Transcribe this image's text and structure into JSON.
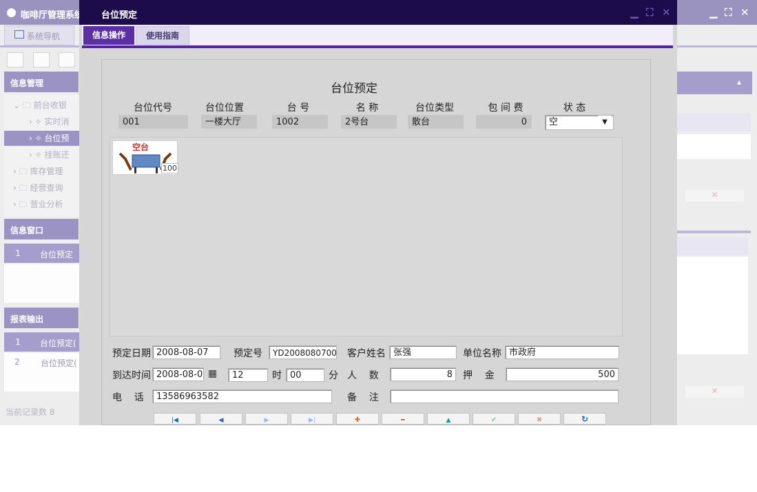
{
  "app": {
    "title": "咖啡厅管理系统",
    "nav_tab": "系统导航",
    "panels": {
      "info_manage": "信息管理",
      "info_window": "信息窗口",
      "report_output": "报表输出"
    },
    "tree": [
      {
        "label": "前台收银",
        "arrow": "⌄",
        "icon": "folder-icon"
      },
      {
        "label": "实时消",
        "arrow": "›",
        "icon": "tool-icon"
      },
      {
        "label": "台位预",
        "arrow": "›",
        "icon": "tool-icon",
        "selected": true
      },
      {
        "label": "挂账还",
        "arrow": "›",
        "icon": "tool-icon"
      },
      {
        "label": "库存管理",
        "arrow": "›",
        "icon": "folder-icon"
      },
      {
        "label": "经营查询",
        "arrow": "›",
        "icon": "folder-icon"
      },
      {
        "label": "营业分析",
        "arrow": "›",
        "icon": "folder-icon"
      }
    ],
    "info_window_grid": {
      "num": "1",
      "cell": "台位预定"
    },
    "report_grid": {
      "head_num": "1",
      "head_cell": "台位预定(",
      "row_num": "2",
      "row_cell": "台位预定("
    },
    "status": "当前记录数 8"
  },
  "dialog": {
    "title": "台位预定",
    "tabs": [
      "信息操作",
      "使用指南"
    ],
    "form_title": "台位预定",
    "columns": [
      "台位代号",
      "台位位置",
      "台 号",
      "名 称",
      "台位类型",
      "包 间 费",
      "状 态"
    ],
    "values": {
      "code": "001",
      "location": "一楼大厅",
      "table_no": "1002",
      "name": "2号台",
      "type": "散台",
      "room_fee": "0",
      "status": "空"
    },
    "table_card": {
      "sign": "空台",
      "number": "100"
    },
    "fields": {
      "reserve_date_label": "预定日期",
      "reserve_date": "2008-08-07",
      "reserve_no_label": "预定号",
      "reserve_no": "YD2008080700",
      "customer_label": "客户姓名",
      "customer": "张强",
      "company_label": "单位名称",
      "company": "市政府",
      "arrive_label": "到达时间",
      "arrive_date": "2008-08-0",
      "hour": "12",
      "hour_label": "时",
      "minute": "00",
      "minute_label": "分",
      "people_label": "人    数",
      "people": "8",
      "deposit_label": "押    金",
      "deposit": "500",
      "phone_label": "电    话",
      "phone": "13586963582",
      "remark_label": "备    注",
      "remark": ""
    },
    "nav_buttons": [
      {
        "name": "first-record-icon",
        "glyph": "|◀",
        "color": "#1d5fc8"
      },
      {
        "name": "prev-record-icon",
        "glyph": "◀",
        "color": "#1d5fc8"
      },
      {
        "name": "next-record-icon",
        "glyph": "▶",
        "color": "#9ab6e2"
      },
      {
        "name": "last-record-icon",
        "glyph": "▶|",
        "color": "#9ab6e2"
      },
      {
        "name": "add-icon",
        "glyph": "✚",
        "color": "#e06a1a"
      },
      {
        "name": "delete-icon",
        "glyph": "━",
        "color": "#d42b2b"
      },
      {
        "name": "edit-icon",
        "glyph": "▲",
        "color": "#0f9a9a"
      },
      {
        "name": "save-icon",
        "glyph": "✔",
        "color": "#8cc08c"
      },
      {
        "name": "cancel-icon",
        "glyph": "✖",
        "color": "#e49a9a"
      },
      {
        "name": "refresh-icon",
        "glyph": "↻",
        "color": "#1d5fc8"
      }
    ]
  }
}
